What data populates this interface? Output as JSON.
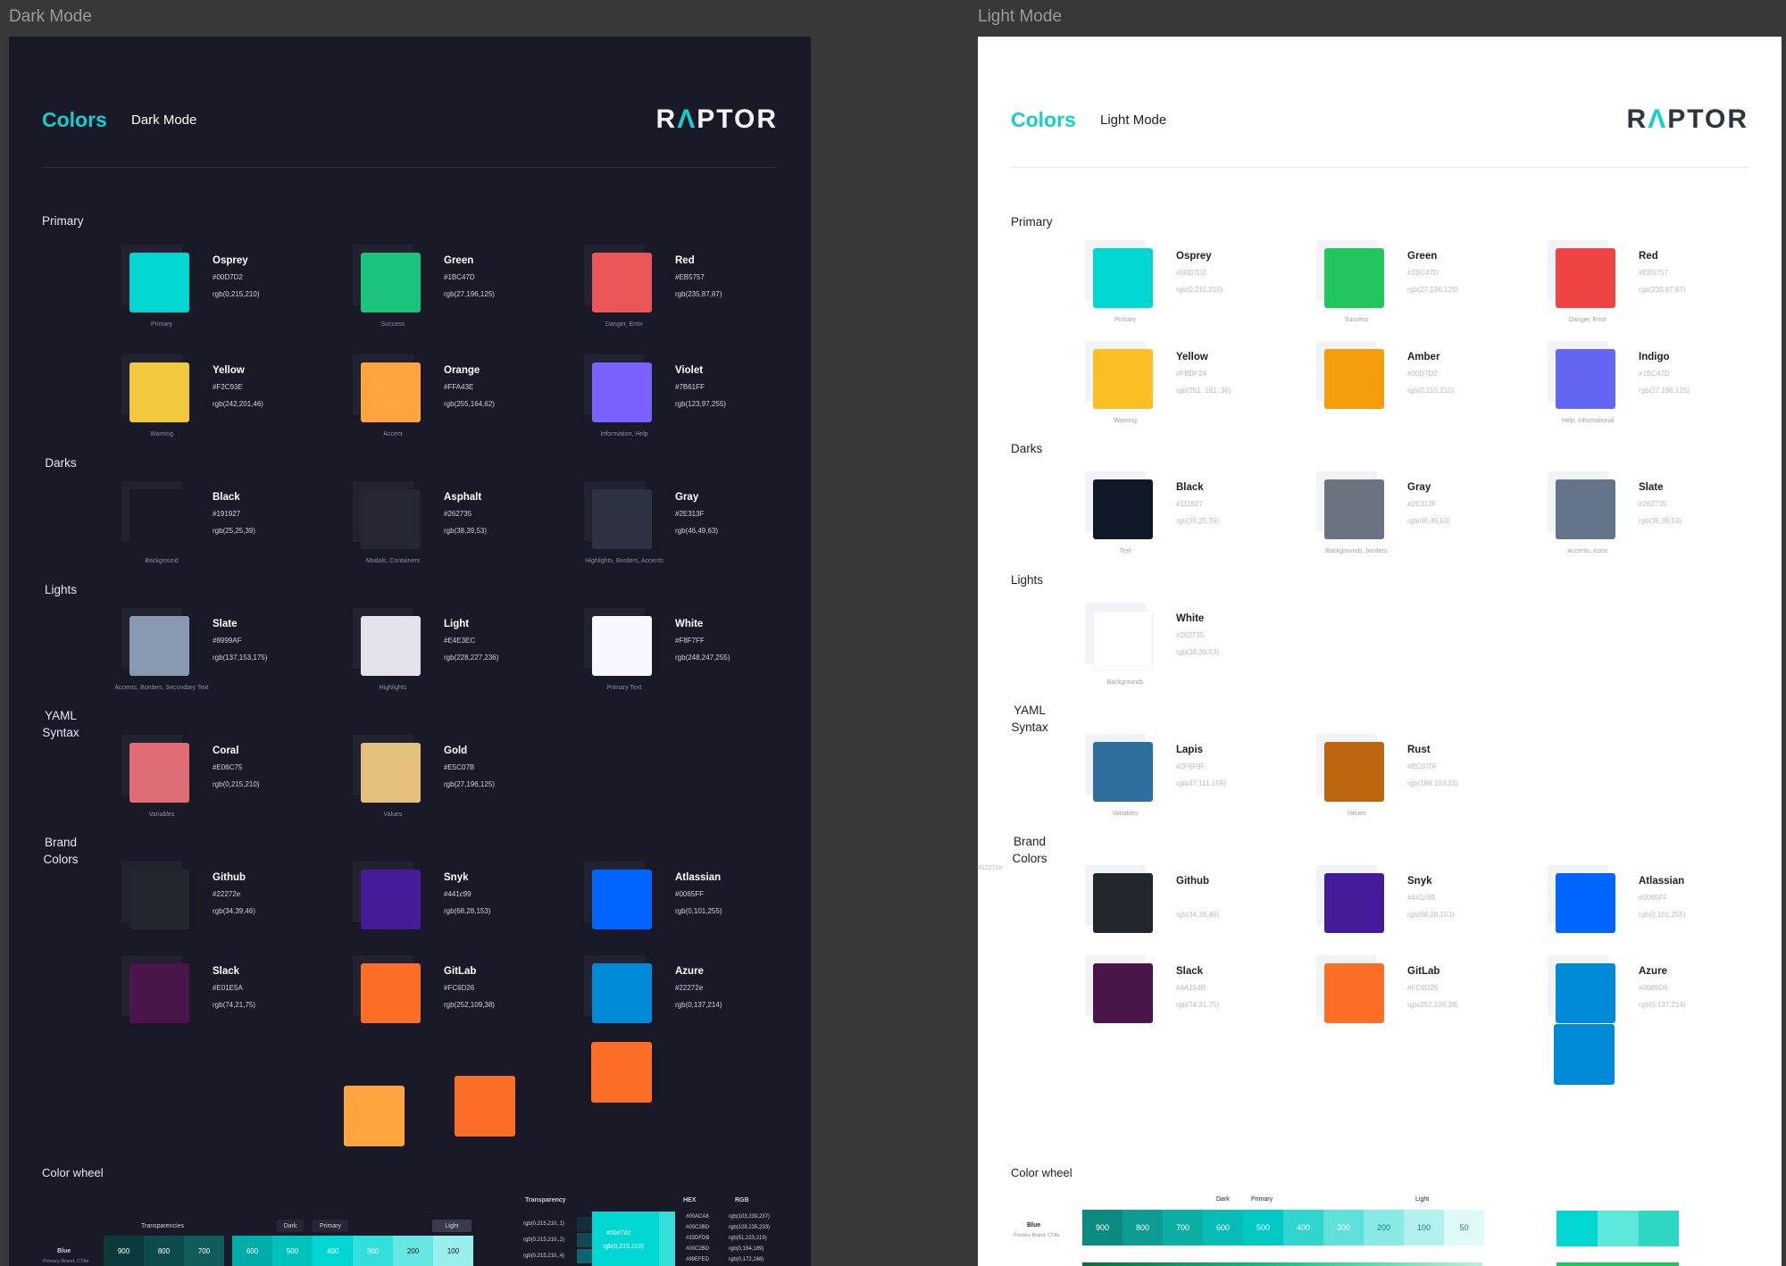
{
  "canvas": {
    "dark_label": "Dark Mode",
    "light_label": "Light Mode"
  },
  "dark": {
    "header": {
      "colors": "Colors",
      "mode": "Dark Mode",
      "logo_a": "R",
      "logo_b": "Λ",
      "logo_c": "PTOR"
    },
    "sections": {
      "primary": "Primary",
      "darks": "Darks",
      "lights": "Lights",
      "yaml": "YAML Syntax",
      "brand": "Brand Colors"
    },
    "swatches": [
      {
        "name": "Osprey",
        "hex": "#00D7D2",
        "rgb": "rgb(0,215,210)",
        "use": "Primary",
        "color": "#00D7D2"
      },
      {
        "name": "Green",
        "hex": "#1BC47D",
        "rgb": "rgb(27,196,125)",
        "use": "Success",
        "color": "#1BC47D"
      },
      {
        "name": "Red",
        "hex": "#EB5757",
        "rgb": "rgb(235,87,87)",
        "use": "Danger, Error",
        "color": "#EB5757"
      },
      {
        "name": "Yellow",
        "hex": "#F2C93E",
        "rgb": "rgb(242,201,46)",
        "use": "Warning",
        "color": "#F2C93E"
      },
      {
        "name": "Orange",
        "hex": "#FFA43E",
        "rgb": "rgb(255,164,62)",
        "use": "Accent",
        "color": "#FFA43E"
      },
      {
        "name": "Violet",
        "hex": "#7B61FF",
        "rgb": "rgb(123,97,255)",
        "use": "Information, Help",
        "color": "#7B61FF"
      },
      {
        "name": "Black",
        "hex": "#191927",
        "rgb": "rgb(25,25,39)",
        "use": "Background",
        "color": "#191927"
      },
      {
        "name": "Asphalt",
        "hex": "#262735",
        "rgb": "rgb(38,39,53)",
        "use": "Modals, Containers",
        "color": "#262735"
      },
      {
        "name": "Gray",
        "hex": "#2E313F",
        "rgb": "rgb(46,49,63)",
        "use": "Highlights, Borders, Accents",
        "color": "#2E313F"
      },
      {
        "name": "Slate",
        "hex": "#8999AF",
        "rgb": "rgb(137,153,175)",
        "use": "Accents, Borders, Secondary Text",
        "color": "#8999AF"
      },
      {
        "name": "Light",
        "hex": "#E4E3EC",
        "rgb": "rgb(228,227,236)",
        "use": "Highlights",
        "color": "#E4E3EC"
      },
      {
        "name": "White",
        "hex": "#F8F7FF",
        "rgb": "rgb(248,247,255)",
        "use": "Primary Text",
        "color": "#F8F7FF"
      },
      {
        "name": "Coral",
        "hex": "#E06C75",
        "rgb": "rgb(0,215,210)",
        "use": "Variables",
        "color": "#E06C75"
      },
      {
        "name": "Gold",
        "hex": "#E5C07B",
        "rgb": "rgb(27,196,125)",
        "use": "Values",
        "color": "#E5C07B"
      },
      {
        "name": "Github",
        "hex": "#22272e",
        "rgb": "rgb(34,39,46)",
        "use": "",
        "color": "#22272E"
      },
      {
        "name": "Snyk",
        "hex": "#441c99",
        "rgb": "rgb(68,28,153)",
        "use": "",
        "color": "#441C99"
      },
      {
        "name": "Atlassian",
        "hex": "#0065FF",
        "rgb": "rgb(0,101,255)",
        "use": "",
        "color": "#0065FF"
      },
      {
        "name": "Slack",
        "hex": "#E01E5A",
        "rgb": "rgb(74,21,75)",
        "use": "",
        "color": "#4A154B"
      },
      {
        "name": "GitLab",
        "hex": "#FC6D26",
        "rgb": "rgb(252,109,38)",
        "use": "",
        "color": "#FC6D26"
      },
      {
        "name": "Azure",
        "hex": "#22272e",
        "rgb": "rgb(0,137,214)",
        "use": "",
        "color": "#0089D6"
      }
    ],
    "loose": [
      {
        "color": "#FFA43E"
      },
      {
        "color": "#FC6D26"
      },
      {
        "color": "#FC6D26"
      }
    ],
    "wheel": {
      "title": "Color wheel",
      "row_name": "Blue",
      "row_sub": "Primary Brand, CTAs",
      "transparencies": "Transparencies",
      "dark": "Dark",
      "primary": "Primary",
      "light": "Light",
      "steps_a": [
        "900",
        "800",
        "700"
      ],
      "steps_b": [
        "600",
        "500",
        "400",
        "300",
        "200",
        "100"
      ],
      "col_transparency": "Transparency",
      "col_hex": "HEX",
      "col_rgb": "RGB",
      "trans_rows": [
        "rgb(0,215,210,.1)",
        "rgb(0,215,210,.2)",
        "rgb(0,215,210,.4)"
      ],
      "center_hex": "#00d7d2",
      "center_rgb": "rgb(0,215,210)",
      "hex_list": [
        "#00ACA8",
        "#00C2BD",
        "#33DFDB",
        "#00C2BD",
        "#99EFED"
      ],
      "rgb_list": [
        "rgb(103,239,237)",
        "rgb(128,235,233)",
        "rgb(51,223,219)",
        "rgb(0,194,189)",
        "rgb(0,172,168)"
      ]
    }
  },
  "light": {
    "header": {
      "colors": "Colors",
      "mode": "Light Mode",
      "logo_a": "R",
      "logo_b": "Λ",
      "logo_c": "PTOR"
    },
    "sections": {
      "primary": "Primary",
      "darks": "Darks",
      "lights": "Lights",
      "yaml": "YAML Syntax",
      "brand": "Brand Colors"
    },
    "stray": "#22272e",
    "swatches": [
      {
        "name": "Osprey",
        "hex": "#00D7D2",
        "rgb": "rgb(0,215,210)",
        "use": "Primary",
        "color": "#00D7D2"
      },
      {
        "name": "Green",
        "hex": "#1BC47D",
        "rgb": "rgb(27,196,125)",
        "use": "Success",
        "color": "#22C55E"
      },
      {
        "name": "Red",
        "hex": "#EB5757",
        "rgb": "rgb(235,87,87)",
        "use": "Danger, Error",
        "color": "#EF4444"
      },
      {
        "name": "Yellow",
        "hex": "#FBBF24",
        "rgb": "rgb(251, 191, 36)",
        "use": "Warning",
        "color": "#FBBF24"
      },
      {
        "name": "Amber",
        "hex": "#00D7D2",
        "rgb": "rgb(0,215,210)",
        "use": "",
        "color": "#F59E0B"
      },
      {
        "name": "Indigo",
        "hex": "#1BC47D",
        "rgb": "rgb(27,196,125)",
        "use": "Help, Informational",
        "color": "#6366F1"
      },
      {
        "name": "Black",
        "hex": "#111827",
        "rgb": "rgb(25,25,39)",
        "use": "Text",
        "color": "#111827"
      },
      {
        "name": "Gray",
        "hex": "#2E313F",
        "rgb": "rgb(46,49,63)",
        "use": "Backgrounds, borders",
        "color": "#6B7280"
      },
      {
        "name": "Slate",
        "hex": "#262735",
        "rgb": "rgb(38,39,53)",
        "use": "Accents, icons",
        "color": "#64748B"
      },
      {
        "name": "White",
        "hex": "#262735",
        "rgb": "rgb(38,39,53)",
        "use": "Backgrounds",
        "color": "#FFFFFF"
      },
      {
        "name": "Lapis",
        "hex": "#2F6F9F",
        "rgb": "rgb(47,111,159)",
        "use": "Variables",
        "color": "#2F6F9F"
      },
      {
        "name": "Rust",
        "hex": "#BC670F",
        "rgb": "rgb(188,103,15)",
        "use": "Values",
        "color": "#BC670F"
      },
      {
        "name": "Github",
        "hex": "",
        "rgb": "rgb(34,39,46)",
        "use": "",
        "color": "#22272E"
      },
      {
        "name": "Snyk",
        "hex": "#441c99",
        "rgb": "rgb(68,28,153)",
        "use": "",
        "color": "#441C99"
      },
      {
        "name": "Atlassian",
        "hex": "#0065FF",
        "rgb": "rgb(0,101,255)",
        "use": "",
        "color": "#0065FF"
      },
      {
        "name": "Slack",
        "hex": "#4A154B",
        "rgb": "rgb(74,21,75)",
        "use": "",
        "color": "#4A154B"
      },
      {
        "name": "GitLab",
        "hex": "#FC6D26",
        "rgb": "rgb(252,109,38)",
        "use": "",
        "color": "#FC6D26"
      },
      {
        "name": "Azure",
        "hex": "#0089D6",
        "rgb": "rgb(0,137,214)",
        "use": "",
        "color": "#0089D6"
      }
    ],
    "loose": [
      {
        "color": "#0089D6"
      }
    ],
    "wheel": {
      "title": "Color wheel",
      "row_name": "Blue",
      "row_sub": "Primary Brand, CTAs",
      "dark": "Dark",
      "primary": "Primary",
      "light": "Light",
      "steps": [
        "900",
        "800",
        "700",
        "600",
        "500",
        "400",
        "300",
        "200",
        "100",
        "50"
      ]
    }
  }
}
